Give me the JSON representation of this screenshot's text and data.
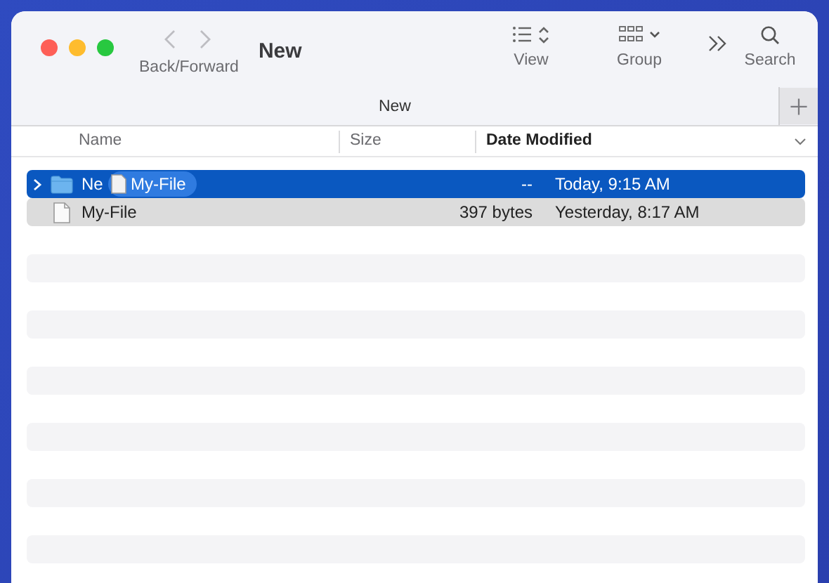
{
  "window": {
    "title": "New"
  },
  "toolbar": {
    "nav": {
      "label": "Back/Forward",
      "back_disabled": true,
      "forward_disabled": true
    },
    "items": [
      {
        "kind": "view",
        "label": "View"
      },
      {
        "kind": "group",
        "label": "Group"
      },
      {
        "kind": "more"
      },
      {
        "kind": "search",
        "label": "Search"
      }
    ]
  },
  "tabs": [
    {
      "label": "New",
      "selected": true
    }
  ],
  "table": {
    "columns": [
      {
        "label": "Name",
        "sorted": false
      },
      {
        "label": "Size",
        "sorted": false
      },
      {
        "label": "Date Modified",
        "sorted": true
      }
    ],
    "rows": [
      {
        "kind": "folder",
        "name": "Ne",
        "size": "--",
        "date": "Today, 9:15 AM",
        "selected": true,
        "highlighted": false,
        "expanded": false
      },
      {
        "kind": "file",
        "name": "My-File",
        "size": "397 bytes",
        "date": "Yesterday, 8:17 AM",
        "selected": false,
        "highlighted": true
      }
    ]
  },
  "drag_item": {
    "label": "My-File"
  }
}
